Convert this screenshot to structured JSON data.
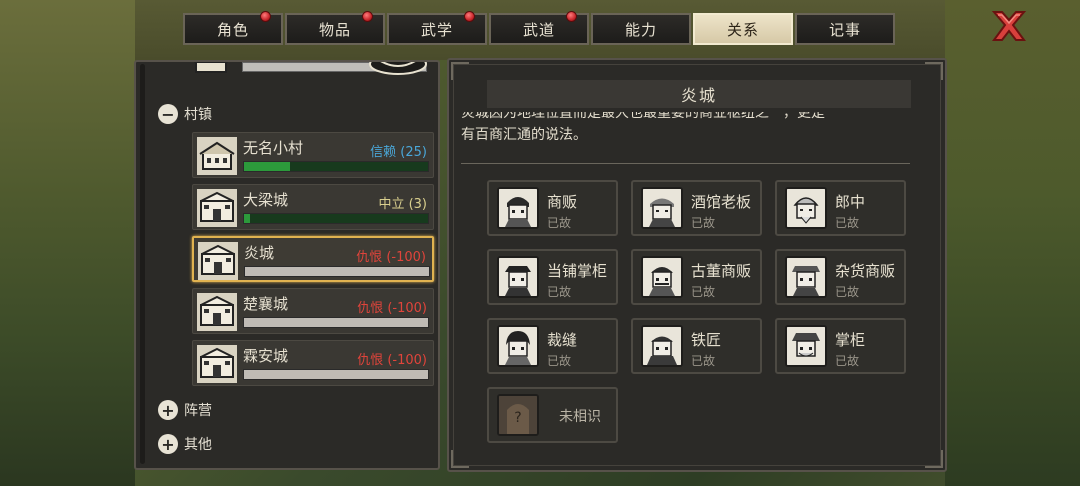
{
  "tabs": [
    {
      "label": "角色",
      "alert": true
    },
    {
      "label": "物品",
      "alert": true
    },
    {
      "label": "武学",
      "alert": true
    },
    {
      "label": "武道",
      "alert": true
    },
    {
      "label": "能力",
      "alert": false
    },
    {
      "label": "关系",
      "alert": false,
      "active": true
    },
    {
      "label": "记事",
      "alert": false
    }
  ],
  "close_icon": "close-x-icon",
  "left": {
    "group_village": {
      "label": "村镇",
      "icon": "minus-icon"
    },
    "towns": [
      {
        "name": "无名小村",
        "status": "信赖 (25)",
        "status_color": "#4aa7d8",
        "level": 0.25,
        "bar": "green"
      },
      {
        "name": "大梁城",
        "status": "中立 (3)",
        "status_color": "#d9cf8e",
        "level": 0.03,
        "bar": "green-dark"
      },
      {
        "name": "炎城",
        "status": "仇恨 (-100)",
        "status_color": "#e0443b",
        "level": -1.0,
        "bar": "gray",
        "selected": true
      },
      {
        "name": "楚襄城",
        "status": "仇恨 (-100)",
        "status_color": "#e0443b",
        "level": -1.0,
        "bar": "gray"
      },
      {
        "name": "霖安城",
        "status": "仇恨 (-100)",
        "status_color": "#e0443b",
        "level": -1.0,
        "bar": "gray"
      }
    ],
    "group_camp": {
      "label": "阵营",
      "icon": "plus-icon"
    },
    "group_other": {
      "label": "其他",
      "icon": "plus-icon"
    }
  },
  "right": {
    "title": "炎城",
    "description_line1": "炎城因为地理位置而是最大也最重要的商业枢纽之一，更是",
    "description_line2": "有百商汇通的说法。",
    "npcs": [
      {
        "name": "商贩",
        "status": "已故"
      },
      {
        "name": "酒馆老板",
        "status": "已故"
      },
      {
        "name": "郎中",
        "status": "已故"
      },
      {
        "name": "当铺掌柜",
        "status": "已故"
      },
      {
        "name": "古董商贩",
        "status": "已故"
      },
      {
        "name": "杂货商贩",
        "status": "已故"
      },
      {
        "name": "裁缝",
        "status": "已故"
      },
      {
        "name": "铁匠",
        "status": "已故"
      },
      {
        "name": "掌柜",
        "status": "已故"
      }
    ],
    "unknown": {
      "label": "未相识",
      "mark": "?"
    }
  }
}
